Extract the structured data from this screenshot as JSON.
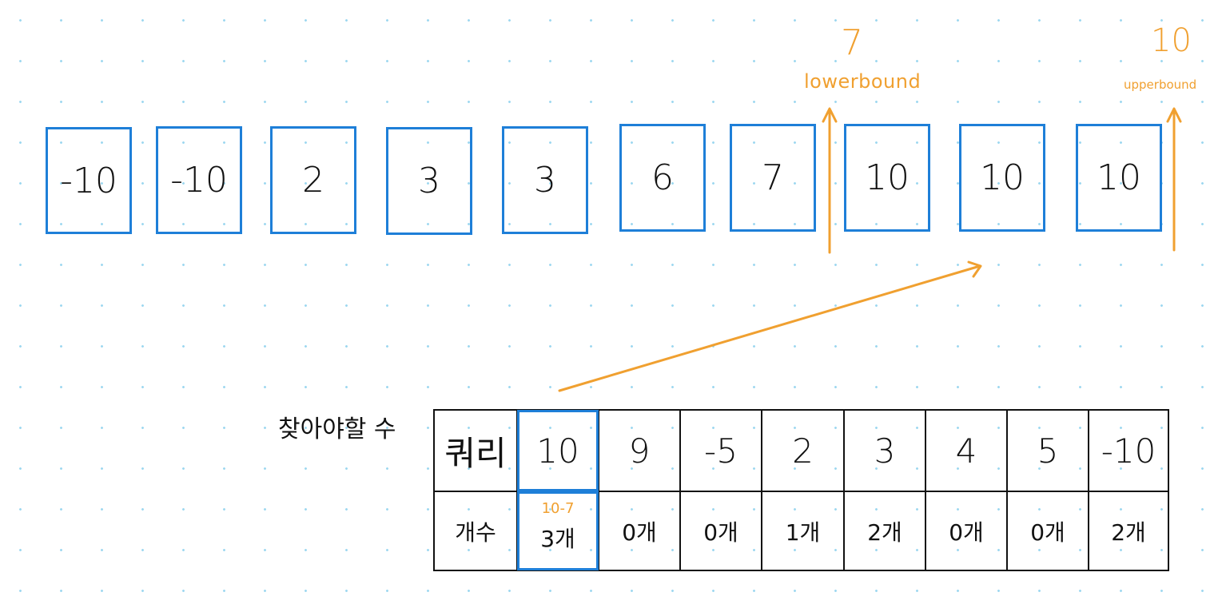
{
  "array": {
    "items": [
      "-10",
      "-10",
      "2",
      "3",
      "3",
      "6",
      "7",
      "10",
      "10",
      "10"
    ]
  },
  "lowerbound": {
    "value": "7",
    "label": "lowerbound"
  },
  "upperbound": {
    "value": "10",
    "label": "upperbound"
  },
  "query_table": {
    "title": "찾아야할 수",
    "row1_header": "쿼리",
    "row2_header": "개수",
    "queries": [
      "10",
      "9",
      "-5",
      "2",
      "3",
      "4",
      "5",
      "-10"
    ],
    "counts": [
      "3개",
      "0개",
      "0개",
      "1개",
      "2개",
      "0개",
      "0개",
      "2개"
    ],
    "note": "10-7"
  },
  "colors": {
    "box_border": "#1e7fd8",
    "annotation": "#f0a030",
    "grid_dots": "#9ed8f0"
  }
}
